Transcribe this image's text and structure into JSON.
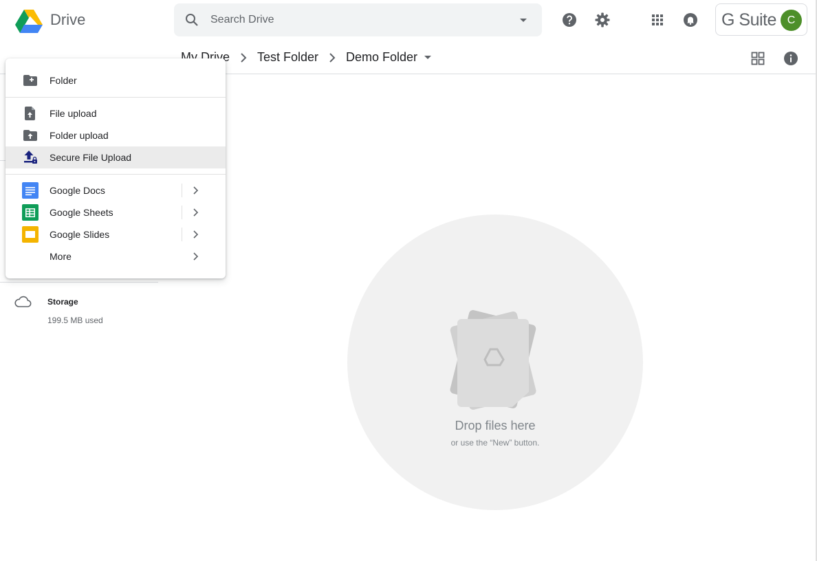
{
  "app": {
    "name": "Drive"
  },
  "search": {
    "placeholder": "Search Drive"
  },
  "account": {
    "brand": "G Suite",
    "avatar_letter": "C",
    "avatar_color": "#4d8f2a"
  },
  "breadcrumb": {
    "items": [
      "My Drive",
      "Test Folder",
      "Demo Folder"
    ]
  },
  "new_menu": {
    "folder": "Folder",
    "file_upload": "File upload",
    "folder_upload": "Folder upload",
    "secure_upload": "Secure File Upload",
    "docs": "Google Docs",
    "sheets": "Google Sheets",
    "slides": "Google Slides",
    "more": "More"
  },
  "storage": {
    "title": "Storage",
    "used": "199.5 MB used"
  },
  "empty_state": {
    "title": "Drop files here",
    "subtitle": "or use the “New” button."
  },
  "icons": {
    "header": [
      "search-icon",
      "dropdown-arrow-icon",
      "help-icon",
      "settings-icon",
      "apps-grid-icon",
      "notifications-icon"
    ],
    "bar": [
      "grid-view-icon",
      "info-icon"
    ]
  },
  "colors": {
    "docs": "#4285f4",
    "sheets": "#0f9d58",
    "slides": "#f4b400",
    "secure_upload": "#1a237e",
    "menu_active": "#ebebeb"
  }
}
